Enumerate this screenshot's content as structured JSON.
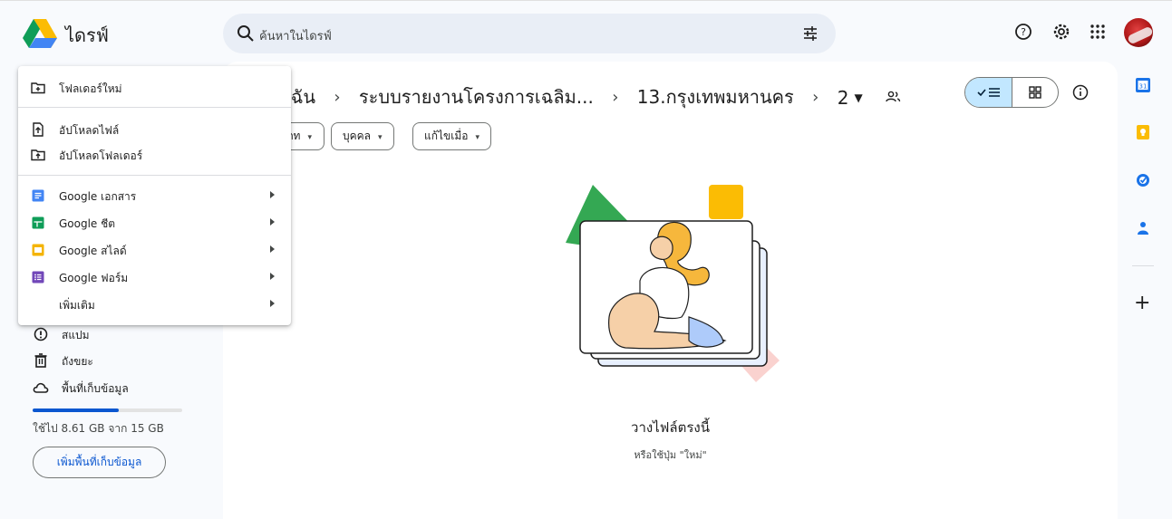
{
  "header": {
    "app_name": "ไดรฟ์",
    "search_placeholder": "ค้นหาในไดรฟ์",
    "icons": [
      "drive-logo",
      "search-icon",
      "filter-icon",
      "help-icon",
      "settings-icon",
      "apps-icon",
      "avatar"
    ]
  },
  "breadcrumb": {
    "items": [
      "ไดรฟ์ของฉัน",
      "ระบบรายงานโครงการเฉลิม...",
      "13.กรุงเทพมหานคร",
      "2"
    ],
    "visible_first": "บฉัน",
    "separator": "›"
  },
  "filters": {
    "chips": [
      "ประเภท",
      "บุคคล",
      "แก้ไขเมื่อ"
    ],
    "chip_caret": "▾"
  },
  "empty_state": {
    "title": "วางไฟล์ตรงนี้",
    "subtitle": "หรือใช้ปุ่ม \"ใหม่\""
  },
  "new_menu": {
    "items": [
      {
        "label": "โฟลเดอร์ใหม่",
        "icon": "new-folder-icon",
        "submenu": false
      },
      {
        "label": "อัปโหลดไฟล์",
        "icon": "file-upload-icon",
        "submenu": false
      },
      {
        "label": "อัปโหลดโฟลเดอร์",
        "icon": "folder-upload-icon",
        "submenu": false
      },
      {
        "label": "Google เอกสาร",
        "icon": "google-docs-icon",
        "submenu": true
      },
      {
        "label": "Google ชีต",
        "icon": "google-sheets-icon",
        "submenu": true
      },
      {
        "label": "Google สไลด์",
        "icon": "google-slides-icon",
        "submenu": true
      },
      {
        "label": "Google ฟอร์ม",
        "icon": "google-forms-icon",
        "submenu": true
      },
      {
        "label": "เพิ่มเติม",
        "icon": "",
        "submenu": true
      }
    ]
  },
  "sidebar": {
    "items": [
      {
        "label": "สแปม",
        "icon": "spam-icon"
      },
      {
        "label": "ถังขยะ",
        "icon": "trash-icon"
      },
      {
        "label": "พื้นที่เก็บข้อมูล",
        "icon": "cloud-icon"
      }
    ],
    "storage_text": "ใช้ไป 8.61 GB จาก 15 GB",
    "storage_used_fraction": 0.574,
    "get_storage_label": "เพิ่มพื้นที่เก็บข้อมูล"
  },
  "right_rail": {
    "icons": [
      "calendar-icon",
      "keep-icon",
      "tasks-icon",
      "contacts-icon"
    ],
    "add_label": "+"
  },
  "colors": {
    "accent_blue": "#0b57d0",
    "selected_toggle": "#c2e7ff",
    "docs": "#4285f4",
    "sheets": "#0f9d58",
    "slides": "#f4b400",
    "forms": "#7248b9"
  }
}
